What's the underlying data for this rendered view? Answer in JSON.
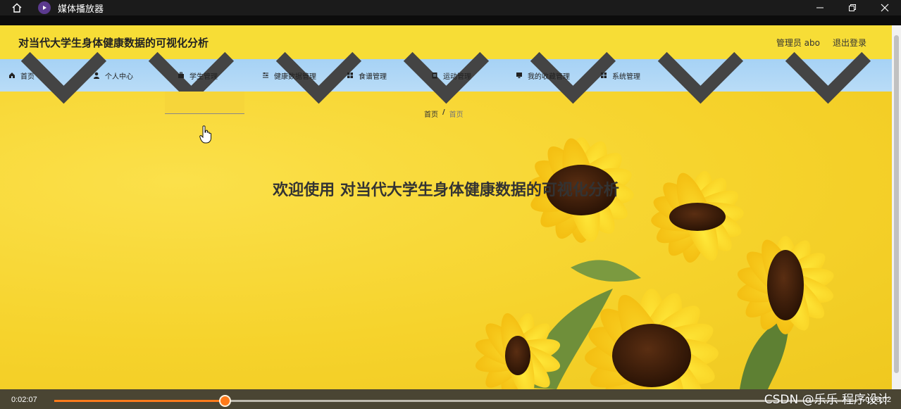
{
  "player": {
    "app_title": "媒体播放器",
    "current_time": "0:02:07",
    "total_time": "0:08:02",
    "progress": 0.212,
    "accent_color": "#ff7a1a"
  },
  "site": {
    "title": "对当代大学生身体健康数据的可视化分析",
    "admin_label": "管理员 abo",
    "logout_label": "退出登录"
  },
  "nav": {
    "items": [
      {
        "label": "首页",
        "icon": "home-icon",
        "has_dropdown": false
      },
      {
        "label": "个人中心",
        "icon": "user-icon",
        "has_dropdown": true
      },
      {
        "label": "学生管理",
        "icon": "briefcase-icon",
        "has_dropdown": true
      },
      {
        "label": "健康数据管理",
        "icon": "sliders-icon",
        "has_dropdown": true
      },
      {
        "label": "食谱管理",
        "icon": "grid-icon",
        "has_dropdown": true
      },
      {
        "label": "运动管理",
        "icon": "clipboard-icon",
        "has_dropdown": true
      },
      {
        "label": "我的收藏管理",
        "icon": "monitor-icon",
        "has_dropdown": true
      },
      {
        "label": "系统管理",
        "icon": "grid-icon",
        "has_dropdown": true
      }
    ]
  },
  "breadcrumb": {
    "root": "首页",
    "separator": "/",
    "current": "首页"
  },
  "hero": {
    "welcome": "欢迎使用 对当代大学生身体健康数据的可视化分析"
  },
  "watermark": "CSDN @乐乐 程序设计",
  "colors": {
    "page_bg": "#f5d630",
    "nav_bg": "#a6d2f5"
  }
}
